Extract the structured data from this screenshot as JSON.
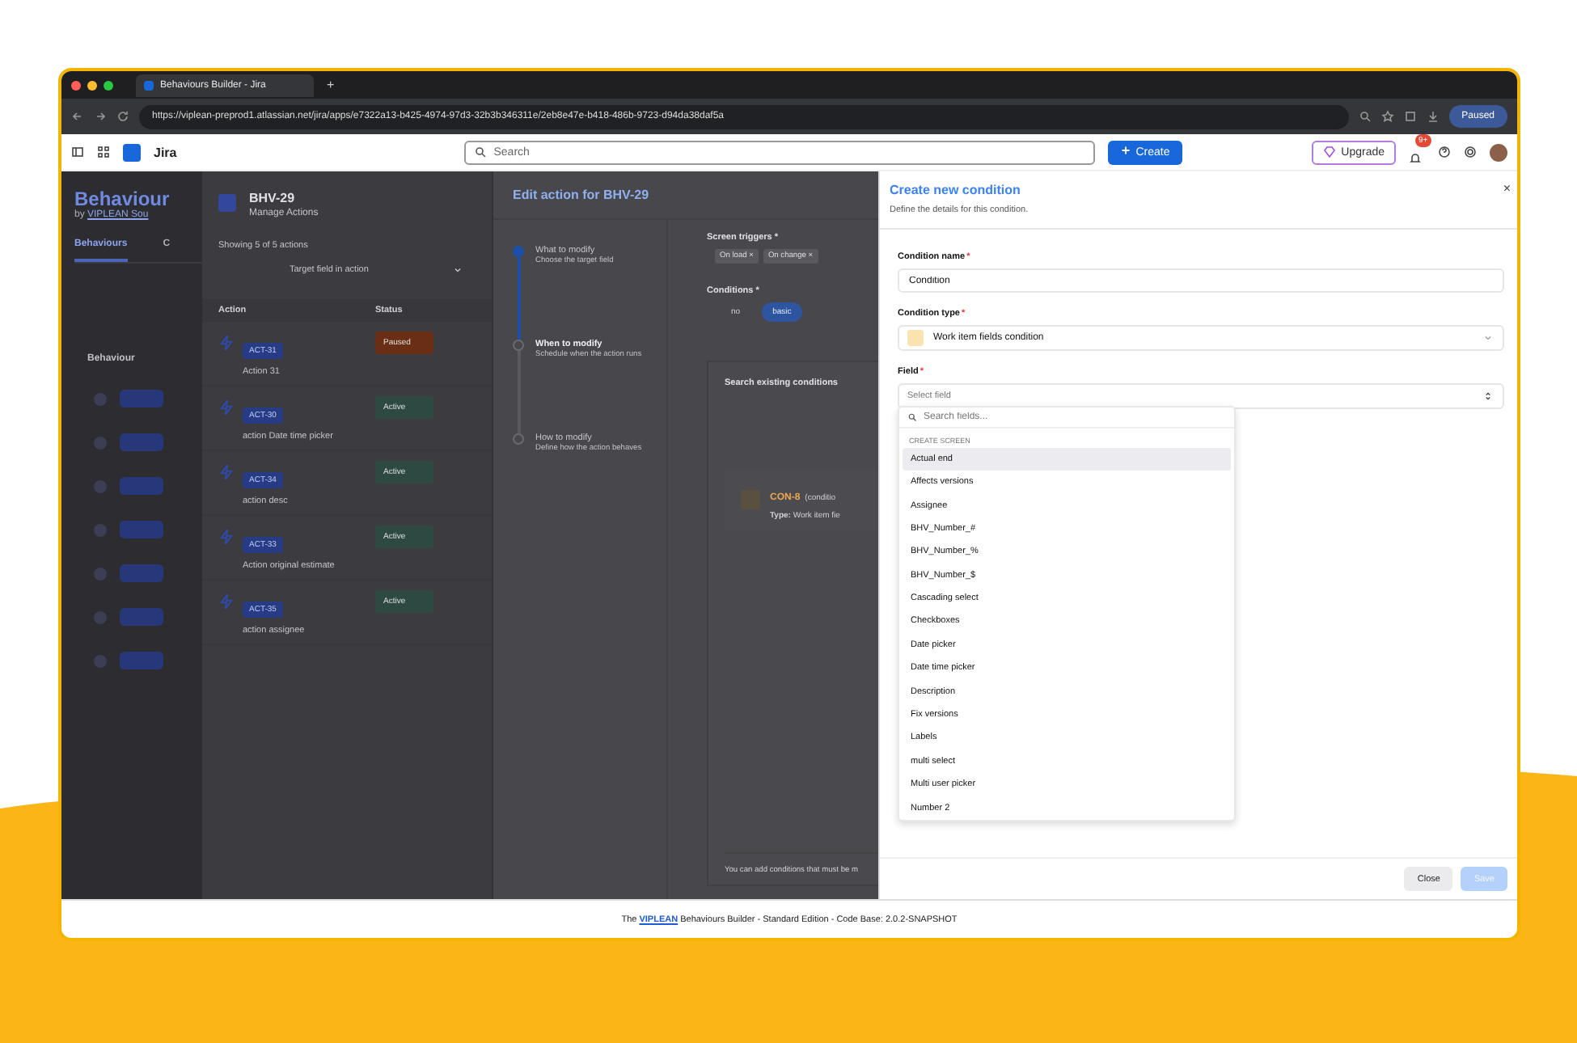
{
  "browser": {
    "tab_title": "Behaviours Builder - Jira",
    "new_tab": "+",
    "url": "https://viplean-preprod1.atlassian.net/jira/apps/e7322a13-b425-4974-97d3-32b3b346311e/2eb8e47e-b418-486b-9723-d94da38daf5a",
    "profile_status": "Paused"
  },
  "jira_header": {
    "product": "Jira",
    "search_placeholder": "Search",
    "create": "Create",
    "upgrade": "Upgrade",
    "notifications": "9+"
  },
  "behaviours_page": {
    "title": "Behaviour",
    "byline_prefix": "by ",
    "byline_link": "VIPLEAN Sou",
    "tabs": [
      {
        "label": "Behaviours",
        "selected": true
      },
      {
        "label": "C",
        "selected": false
      }
    ],
    "column": "Behaviour"
  },
  "manage_actions": {
    "key": "BHV-29",
    "subtitle": "Manage Actions",
    "showing": "Showing 5 of 5 actions",
    "filter": "Target field in action",
    "columns": [
      "Action",
      "Status"
    ],
    "rows": [
      {
        "key": "ACT-31",
        "name": "Action 31",
        "status": "Paused",
        "kind": "paused"
      },
      {
        "key": "ACT-30",
        "name": "action Date time picker",
        "status": "Active",
        "kind": "active"
      },
      {
        "key": "ACT-34",
        "name": "action desc",
        "status": "Active",
        "kind": "active"
      },
      {
        "key": "ACT-33",
        "name": "Action original estimate",
        "status": "Active",
        "kind": "active"
      },
      {
        "key": "ACT-35",
        "name": "action assignee",
        "status": "Active",
        "kind": "active"
      }
    ]
  },
  "edit_action": {
    "title": "Edit action for BHV-29",
    "steps": [
      {
        "title": "What to modify",
        "subtitle": "Choose the target field",
        "completed": true,
        "selected": false
      },
      {
        "title": "When to modify",
        "subtitle": "Schedule when the action runs",
        "completed": false,
        "selected": true
      },
      {
        "title": "How to modify",
        "subtitle": "Define how the action behaves",
        "completed": false,
        "selected": false
      }
    ],
    "screen_triggers_label": "Screen triggers *",
    "triggers": [
      "On load ×",
      "On change ×"
    ],
    "conditions_label": "Conditions *",
    "condition_modes": [
      {
        "label": "no",
        "selected": false
      },
      {
        "label": "basic",
        "selected": true
      }
    ],
    "search_title": "Search existing conditions",
    "condition": {
      "key": "CON-8",
      "name": "(conditio",
      "type": "**Type:** Work item fie"
    },
    "hint": "You can add conditions that must be m"
  },
  "create_condition": {
    "title": "Create new condition",
    "subtitle": "Define the details for this condition.",
    "close": "×",
    "name_label": "Condition name",
    "name_value": "Condition",
    "type_label": "Condition type",
    "type_value": "Work item fields condition",
    "field_label": "Field",
    "field_placeholder": "Select field",
    "required": "*",
    "dropdown": {
      "search_placeholder": "Search fields...",
      "group": "CREATE SCREEN",
      "items": [
        {
          "label": "Actual end",
          "selected": true
        },
        {
          "label": "Affects versions",
          "selected": false
        },
        {
          "label": "Assignee",
          "selected": false
        },
        {
          "label": "BHV_Number_#",
          "selected": false
        },
        {
          "label": "BHV_Number_%",
          "selected": false
        },
        {
          "label": "BHV_Number_$",
          "selected": false
        },
        {
          "label": "Cascading select",
          "selected": false
        },
        {
          "label": "Checkboxes",
          "selected": false
        },
        {
          "label": "Date picker",
          "selected": false
        },
        {
          "label": "Date time picker",
          "selected": false
        },
        {
          "label": "Description",
          "selected": false
        },
        {
          "label": "Fix versions",
          "selected": false
        },
        {
          "label": "Labels",
          "selected": false
        },
        {
          "label": "multi select",
          "selected": false
        },
        {
          "label": "Multi user picker",
          "selected": false
        },
        {
          "label": "Number 2",
          "selected": false
        }
      ]
    },
    "buttons": [
      {
        "label": "Close",
        "disabled": false
      },
      {
        "label": "Save",
        "disabled": true
      }
    ]
  },
  "footer": {
    "prefix": "The ",
    "link": "VIPLEAN",
    "suffix": " Behaviours Builder - Standard Edition - Code Base: 2.0.2-SNAPSHOT"
  }
}
